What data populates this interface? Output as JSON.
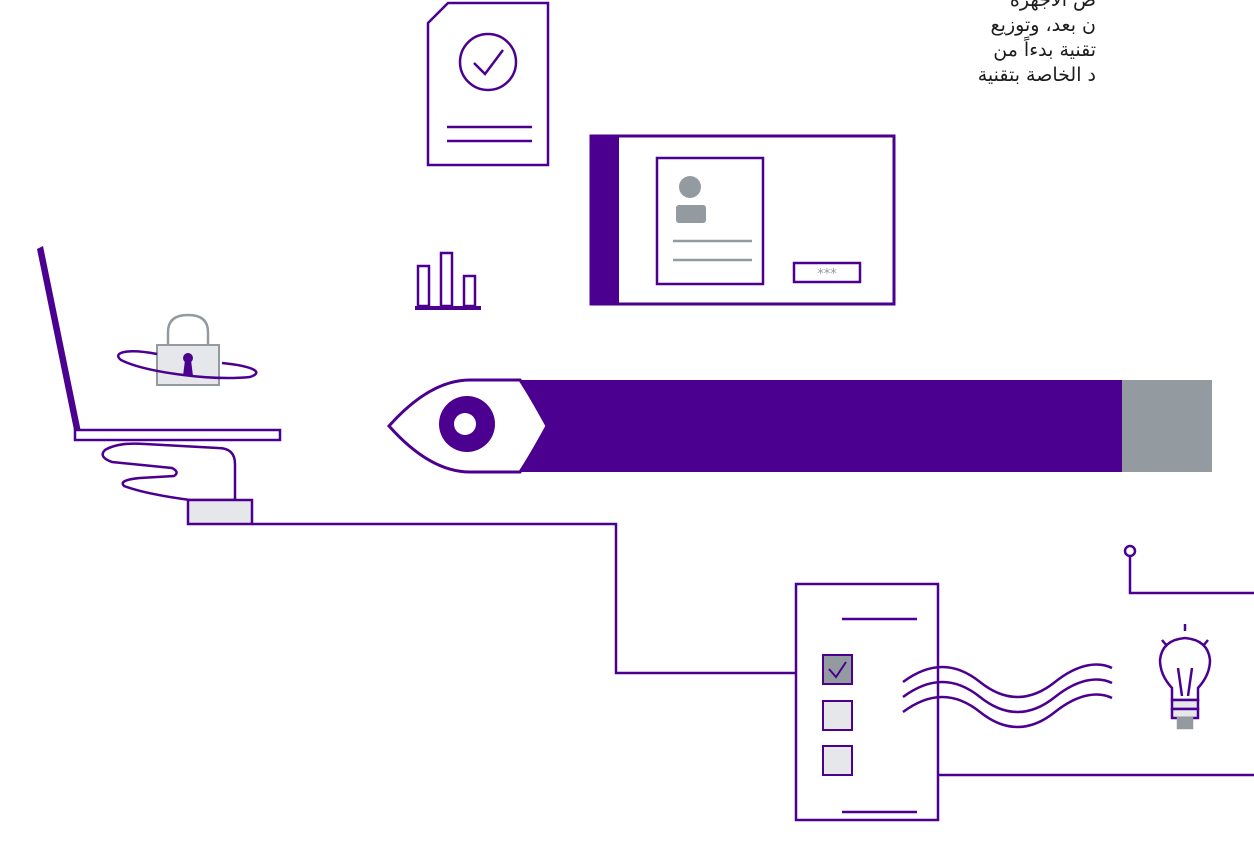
{
  "text_block": {
    "lines": [
      "ض الأجهزة",
      "ن بعد، وتوزيع",
      "تقنية بدءاً من",
      "د الخاصة بتقنية"
    ]
  },
  "id_card": {
    "password_mask": "***"
  },
  "colors": {
    "purple": "#4b0090",
    "gray": "#939aa0",
    "light_gray": "#e6e7ea",
    "white": "#ffffff"
  },
  "icons": [
    "document-check-icon",
    "id-card-icon",
    "bar-chart-icon",
    "padlock-icon",
    "laptop-icon",
    "hand-icon",
    "eye-icon",
    "checklist-icon",
    "lightbulb-icon",
    "wave-lines-icon"
  ]
}
